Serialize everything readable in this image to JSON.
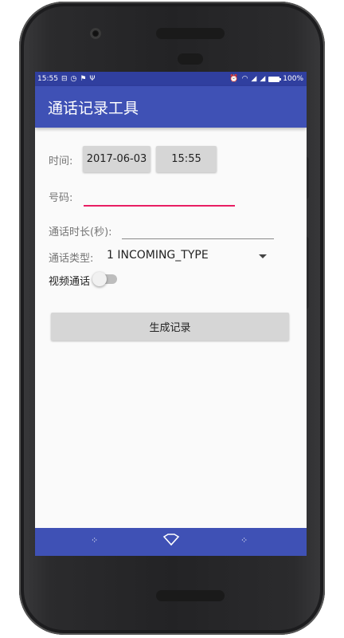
{
  "status_bar": {
    "time": "15:55",
    "battery": "100%",
    "left_icons": [
      "notification-icon",
      "clock-icon",
      "android-icon",
      "usb-icon"
    ],
    "right_icons": [
      "alarm-icon",
      "wifi-icon",
      "signal-icon",
      "signal-icon",
      "battery-icon"
    ]
  },
  "appbar": {
    "title": "通话记录工具"
  },
  "form": {
    "time_label": "时间:",
    "date_button": "2017-06-03",
    "time_button": "15:55",
    "number_label": "号码:",
    "number_value": "",
    "duration_label": "通话时长(秒):",
    "duration_value": "",
    "type_label": "通话类型:",
    "type_selected": "1 INCOMING_TYPE",
    "video_label": "视频通话",
    "video_on": false,
    "generate_button": "生成记录"
  },
  "nav_bar": {
    "icons": [
      "back-icon",
      "home-icon",
      "recents-icon"
    ]
  },
  "colors": {
    "primary": "#3f51b5",
    "primary_dark": "#303f9f",
    "accent": "#e91e63"
  }
}
